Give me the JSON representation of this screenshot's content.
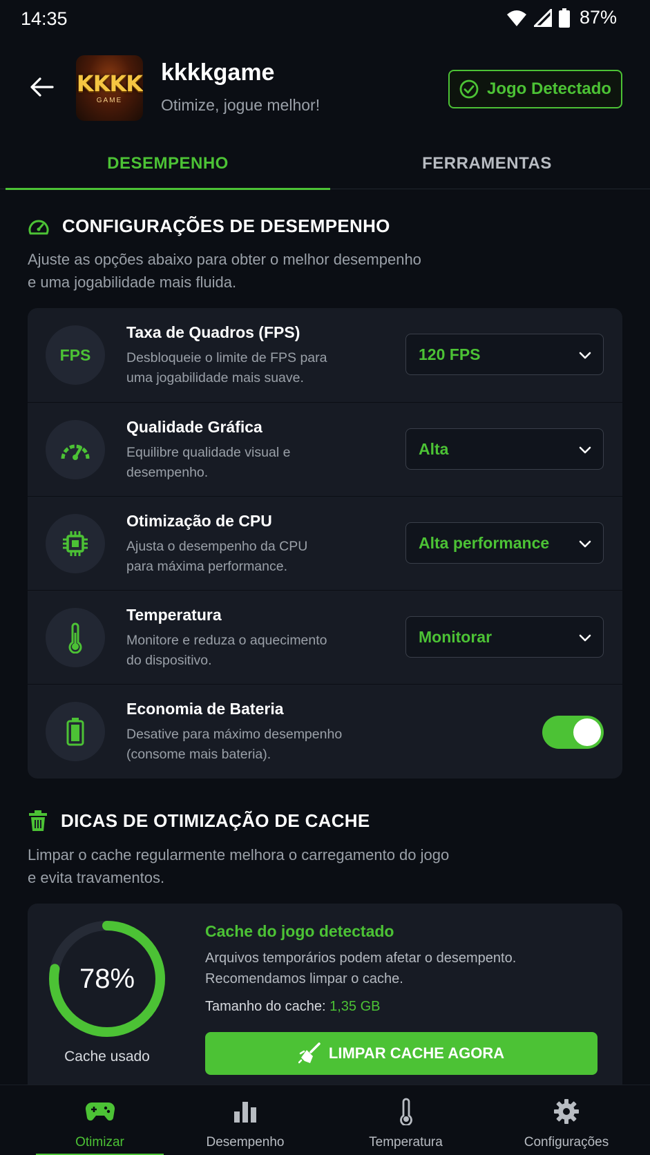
{
  "status_bar": {
    "time": "14:35",
    "battery_percent": "87%"
  },
  "header": {
    "app_name": "kkkkgame",
    "tagline": "Otimize, jogue melhor!",
    "logo_text": "KKKK",
    "logo_subtext": "GAME",
    "detected_label": "Jogo Detectado"
  },
  "tabs": [
    {
      "label": "DESEMPENHO",
      "active": true
    },
    {
      "label": "FERRAMENTAS",
      "active": false
    }
  ],
  "performance": {
    "title": "CONFIGURAÇÕES DE DESEMPENHO",
    "description_line1": "Ajuste as opções abaixo para obter o melhor desempenho",
    "description_line2": "e uma jogabilidade mais fluida.",
    "settings": [
      {
        "icon": "fps-icon",
        "icon_text": "FPS",
        "title": "Taxa de Quadros (FPS)",
        "desc1": "Desbloqueie o limite de FPS para",
        "desc2": "uma jogabilidade mais suave.",
        "control": "select",
        "value": "120 FPS"
      },
      {
        "icon": "speedometer-icon",
        "title": "Qualidade Gráfica",
        "desc1": "Equilibre qualidade visual e",
        "desc2": "desempenho.",
        "control": "select",
        "value": "Alta"
      },
      {
        "icon": "cpu-icon",
        "title": "Otimização de CPU",
        "desc1": "Ajusta o desempenho da CPU",
        "desc2": "para máxima performance.",
        "control": "select",
        "value": "Alta performance"
      },
      {
        "icon": "thermometer-icon",
        "title": "Temperatura",
        "desc1": "Monitore e reduza o aquecimento",
        "desc2": "do dispositivo.",
        "control": "select",
        "value": "Monitorar"
      },
      {
        "icon": "battery-icon",
        "title": "Economia de Bateria",
        "desc1": "Desative para máximo desempenho",
        "desc2": "(consome mais bateria).",
        "control": "toggle",
        "enabled": true
      }
    ]
  },
  "cache": {
    "title": "DICAS DE OTIMIZAÇÃO DE CACHE",
    "description_line1": "Limpar o cache regularmente melhora o carregamento do jogo",
    "description_line2": "e evita travamentos.",
    "usage_percent": "78%",
    "usage_fraction": 0.78,
    "usage_label": "Cache usado",
    "detected_title": "Cache do jogo detectado",
    "detected_desc1": "Arquivos temporários podem afetar o desempento.",
    "detected_desc2": "Recomendamos limpar o cache.",
    "size_label": "Tamanho do cache:",
    "size_value": "1,35 GB",
    "clean_button": "LIMPAR CACHE AGORA"
  },
  "bottom_nav": [
    {
      "label": "Otimizar",
      "icon": "gamepad-icon",
      "active": true
    },
    {
      "label": "Desempenho",
      "icon": "bar-chart-icon",
      "active": false
    },
    {
      "label": "Temperatura",
      "icon": "thermometer-icon",
      "active": false
    },
    {
      "label": "Configurações",
      "icon": "gear-icon",
      "active": false
    }
  ],
  "colors": {
    "accent": "#4cc235",
    "background": "#0b0e14",
    "card": "#171b24"
  }
}
